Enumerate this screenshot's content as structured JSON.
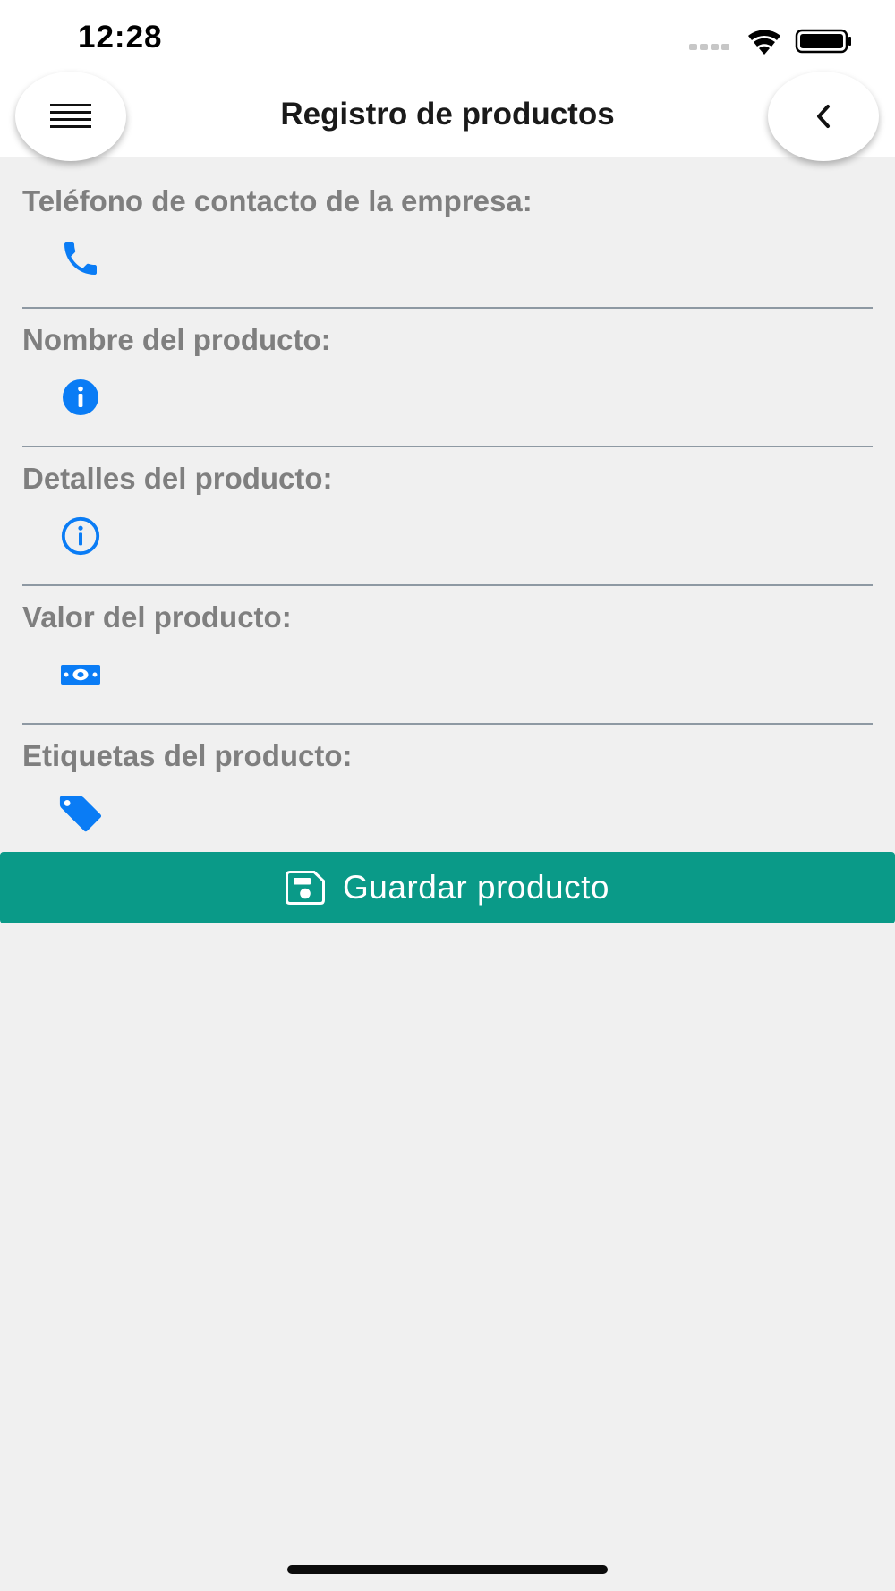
{
  "status_bar": {
    "time": "12:28",
    "icons": [
      "signal-dots-icon",
      "wifi-icon",
      "battery-icon"
    ]
  },
  "header": {
    "title": "Registro de productos",
    "menu_icon": "menu-icon",
    "back_icon": "chevron-left-icon"
  },
  "form": {
    "fields": [
      {
        "label": "Teléfono de contacto de la empresa:",
        "icon": "phone-icon",
        "value": ""
      },
      {
        "label": "Nombre del producto:",
        "icon": "info-filled-icon",
        "value": ""
      },
      {
        "label": "Detalles del producto:",
        "icon": "info-outline-icon",
        "value": ""
      },
      {
        "label": "Valor del producto:",
        "icon": "money-icon",
        "value": ""
      },
      {
        "label": "Etiquetas del producto:",
        "icon": "tag-icon",
        "value": ""
      }
    ],
    "save_label": "Guardar producto",
    "save_icon": "save-icon"
  },
  "colors": {
    "accent": "#0a9a88",
    "icon_blue": "#0a7cf5",
    "label_gray": "#7f7f7f",
    "background": "#f0f0f0"
  }
}
